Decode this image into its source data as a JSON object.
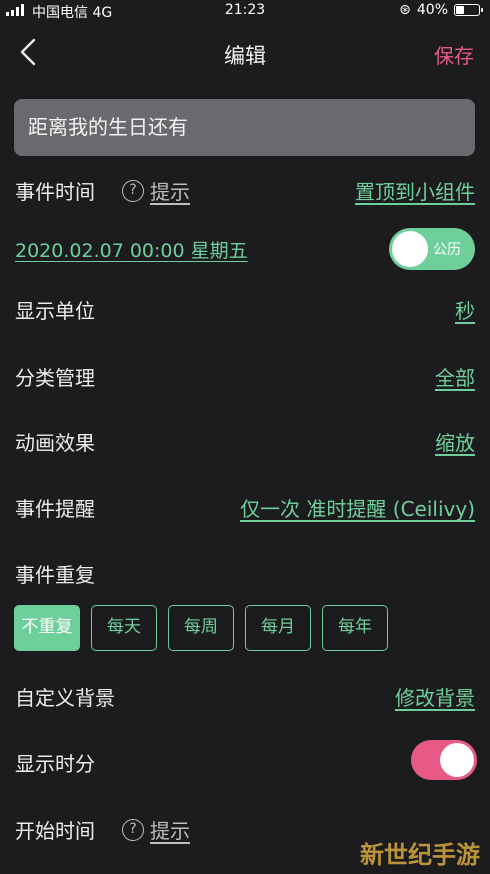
{
  "status_bar": {
    "carrier": "中国电信 4G",
    "time": "21:23",
    "battery": "40%",
    "battery_level": 0.4
  },
  "nav": {
    "title": "编辑",
    "save_label": "保存"
  },
  "event_name": "距离我的生日还有",
  "event_time": {
    "label": "事件时间",
    "hint_label": "提示",
    "pin_label": "置顶到小组件"
  },
  "date": {
    "value": "2020.02.07 00:00  星期五",
    "calendar_label": "公历",
    "calendar_on": true
  },
  "settings": [
    {
      "label": "显示单位",
      "value": "秒"
    },
    {
      "label": "分类管理",
      "value": "全部"
    },
    {
      "label": "动画效果",
      "value": "缩放"
    },
    {
      "label": "事件提醒",
      "value": "仅一次 准时提醒 (Ceilivy)"
    }
  ],
  "repeat": {
    "label": "事件重复",
    "options": [
      "不重复",
      "每天",
      "每周",
      "每月",
      "每年"
    ],
    "selected": "不重复"
  },
  "background": {
    "label": "自定义背景",
    "value": "修改背景"
  },
  "show_hm": {
    "label": "显示时分",
    "on": true
  },
  "start_time": {
    "label": "开始时间",
    "hint_label": "提示"
  },
  "watermark": "新世纪手游",
  "colors": {
    "accent": "#6fcf9b",
    "save": "#e85a86",
    "background": "#1c1c1e"
  }
}
